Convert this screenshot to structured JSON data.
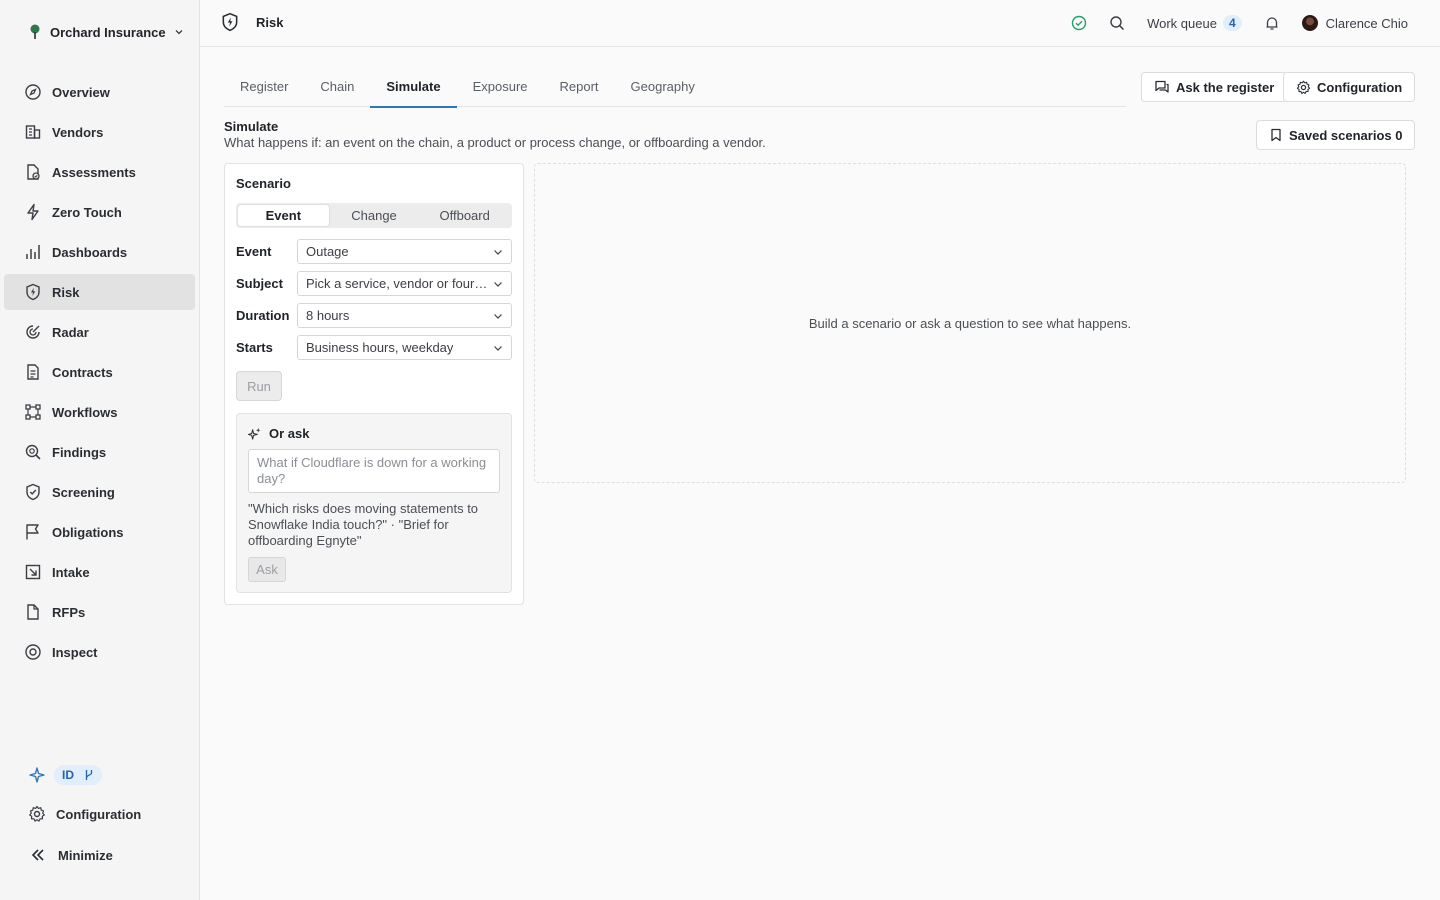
{
  "org": {
    "name": "Orchard Insurance"
  },
  "sidebar": {
    "items": [
      {
        "label": "Overview",
        "icon": "compass-icon"
      },
      {
        "label": "Vendors",
        "icon": "building-icon"
      },
      {
        "label": "Assessments",
        "icon": "document-check-icon"
      },
      {
        "label": "Zero Touch",
        "icon": "lightning-icon"
      },
      {
        "label": "Dashboards",
        "icon": "bar-chart-icon"
      },
      {
        "label": "Risk",
        "icon": "shield-bolt-icon",
        "active": true
      },
      {
        "label": "Radar",
        "icon": "radar-icon"
      },
      {
        "label": "Contracts",
        "icon": "contract-icon"
      },
      {
        "label": "Workflows",
        "icon": "workflow-icon"
      },
      {
        "label": "Findings",
        "icon": "magnifier-icon"
      },
      {
        "label": "Screening",
        "icon": "shield-check-icon"
      },
      {
        "label": "Obligations",
        "icon": "flag-icon"
      },
      {
        "label": "Intake",
        "icon": "intake-icon"
      },
      {
        "label": "RFPs",
        "icon": "file-icon"
      },
      {
        "label": "Inspect",
        "icon": "eye-icon"
      }
    ],
    "badge_text": "ID",
    "configuration_label": "Configuration",
    "minimize_label": "Minimize"
  },
  "topbar": {
    "title": "Risk",
    "work_queue_label": "Work queue",
    "work_queue_count": "4",
    "user_name": "Clarence Chio"
  },
  "tabs": [
    {
      "label": "Register"
    },
    {
      "label": "Chain"
    },
    {
      "label": "Simulate",
      "active": true
    },
    {
      "label": "Exposure"
    },
    {
      "label": "Report"
    },
    {
      "label": "Geography"
    }
  ],
  "actions": {
    "ask_register": "Ask the register",
    "configuration": "Configuration",
    "saved_scenarios": "Saved scenarios 0"
  },
  "section": {
    "title": "Simulate",
    "subtitle": "What happens if: an event on the chain, a product or process change, or offboarding a vendor."
  },
  "scenario": {
    "heading": "Scenario",
    "modes": [
      "Event",
      "Change",
      "Offboard"
    ],
    "fields": [
      {
        "label": "Event",
        "value": "Outage"
      },
      {
        "label": "Subject",
        "value": "Pick a service, vendor or fourth party"
      },
      {
        "label": "Duration",
        "value": "8 hours"
      },
      {
        "label": "Starts",
        "value": "Business hours, weekday"
      }
    ],
    "run_label": "Run",
    "ask": {
      "heading": "Or ask",
      "placeholder": "What if Cloudflare is down for a working day?",
      "hint": "\"Which risks does moving statements to Snowflake India touch?\" · \"Brief for offboarding Egnyte\"",
      "button": "Ask"
    }
  },
  "result": {
    "empty_message": "Build a scenario or ask a question to see what happens."
  },
  "colors": {
    "accent": "#2a76b8",
    "active_nav": "#e2e2e3",
    "badge_bg": "#e1eefb",
    "status_ok": "#22a06b"
  }
}
